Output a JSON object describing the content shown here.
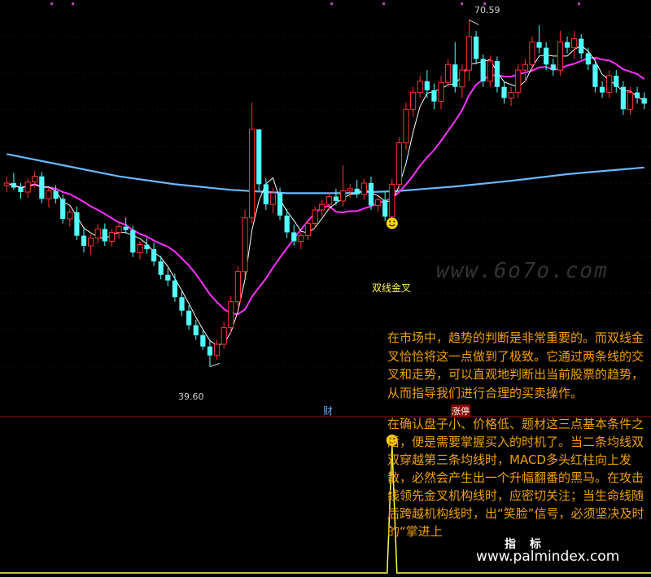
{
  "chart_data": {
    "type": "candlestick",
    "main_panel": {
      "price_range": [
        36,
        72
      ],
      "high_label": "70.59",
      "low_label": "39.60",
      "signal_label": "双线金叉",
      "candles": [
        [
          55.8,
          56.6,
          55.2,
          56.0
        ],
        [
          56.0,
          56.9,
          55.4,
          55.6
        ],
        [
          55.6,
          56.0,
          54.6,
          55.2
        ],
        [
          55.2,
          56.4,
          54.7,
          56.1
        ],
        [
          56.1,
          57.1,
          55.6,
          56.6
        ],
        [
          56.6,
          57.0,
          54.2,
          54.6
        ],
        [
          54.6,
          55.6,
          53.8,
          55.3
        ],
        [
          55.3,
          55.8,
          54.2,
          54.6
        ],
        [
          54.6,
          55.0,
          52.4,
          52.8
        ],
        [
          52.8,
          53.7,
          52.1,
          53.4
        ],
        [
          53.4,
          53.9,
          50.9,
          51.3
        ],
        [
          51.3,
          52.1,
          49.8,
          50.4
        ],
        [
          50.4,
          51.4,
          49.6,
          51.1
        ],
        [
          51.1,
          52.3,
          50.6,
          51.9
        ],
        [
          51.9,
          52.4,
          50.4,
          50.8
        ],
        [
          50.8,
          51.9,
          50.3,
          51.6
        ],
        [
          51.6,
          52.5,
          51.0,
          52.1
        ],
        [
          52.1,
          52.9,
          51.5,
          51.8
        ],
        [
          51.8,
          52.2,
          49.4,
          49.8
        ],
        [
          49.8,
          50.8,
          49.2,
          50.5
        ],
        [
          50.5,
          51.1,
          49.7,
          50.1
        ],
        [
          50.1,
          50.7,
          48.6,
          49.0
        ],
        [
          49.0,
          49.5,
          47.4,
          47.8
        ],
        [
          47.8,
          48.4,
          46.8,
          47.3
        ],
        [
          47.3,
          47.9,
          45.4,
          45.8
        ],
        [
          45.8,
          46.3,
          44.1,
          44.6
        ],
        [
          44.6,
          45.1,
          42.9,
          43.3
        ],
        [
          43.3,
          43.8,
          42.0,
          42.4
        ],
        [
          42.4,
          42.9,
          41.1,
          41.4
        ],
        [
          41.4,
          41.9,
          39.6,
          40.6
        ],
        [
          40.6,
          42.0,
          40.2,
          41.6
        ],
        [
          41.6,
          43.6,
          41.2,
          43.1
        ],
        [
          43.1,
          45.9,
          42.6,
          45.4
        ],
        [
          45.4,
          48.6,
          45.0,
          48.1
        ],
        [
          48.1,
          53.6,
          47.6,
          52.9
        ],
        [
          52.9,
          63.2,
          52.4,
          60.8
        ],
        [
          60.8,
          59.4,
          55.3,
          55.9
        ],
        [
          55.9,
          56.4,
          53.6,
          54.1
        ],
        [
          54.1,
          55.6,
          53.3,
          55.1
        ],
        [
          55.1,
          55.6,
          52.7,
          53.1
        ],
        [
          53.1,
          53.7,
          51.1,
          51.6
        ],
        [
          51.6,
          52.3,
          50.4,
          50.8
        ],
        [
          50.8,
          51.6,
          50.1,
          51.3
        ],
        [
          51.3,
          52.8,
          50.9,
          52.4
        ],
        [
          52.4,
          53.9,
          52.0,
          53.6
        ],
        [
          53.6,
          54.5,
          53.1,
          54.1
        ],
        [
          54.1,
          55.2,
          53.6,
          54.8
        ],
        [
          54.8,
          55.5,
          54.0,
          54.4
        ],
        [
          54.4,
          57.6,
          53.9,
          55.3
        ],
        [
          55.3,
          55.9,
          54.7,
          55.5
        ],
        [
          55.5,
          56.3,
          54.7,
          55.0
        ],
        [
          55.0,
          56.4,
          54.5,
          56.0
        ],
        [
          56.0,
          56.6,
          53.6,
          54.0
        ],
        [
          54.0,
          54.8,
          53.4,
          54.5
        ],
        [
          54.5,
          55.2,
          52.6,
          53.0
        ],
        [
          53.0,
          56.4,
          52.7,
          55.9
        ],
        [
          55.9,
          60.1,
          55.4,
          59.6
        ],
        [
          59.6,
          63.2,
          59.0,
          62.6
        ],
        [
          62.6,
          64.6,
          61.9,
          64.1
        ],
        [
          64.1,
          65.6,
          63.6,
          65.1
        ],
        [
          65.1,
          66.1,
          63.6,
          64.3
        ],
        [
          64.3,
          64.9,
          62.6,
          63.3
        ],
        [
          63.3,
          65.6,
          62.6,
          65.0
        ],
        [
          65.0,
          67.1,
          64.6,
          66.6
        ],
        [
          66.6,
          68.6,
          64.1,
          64.6
        ],
        [
          64.6,
          66.6,
          63.6,
          66.1
        ],
        [
          66.1,
          70.59,
          65.1,
          69.1
        ],
        [
          69.1,
          69.6,
          66.6,
          67.1
        ],
        [
          67.1,
          67.5,
          64.6,
          65.1
        ],
        [
          65.1,
          67.4,
          64.6,
          66.9
        ],
        [
          66.9,
          67.3,
          64.1,
          64.6
        ],
        [
          64.6,
          65.1,
          63.1,
          63.6
        ],
        [
          63.6,
          64.6,
          62.9,
          64.1
        ],
        [
          64.1,
          66.6,
          63.6,
          66.1
        ],
        [
          66.1,
          67.1,
          65.1,
          66.6
        ],
        [
          66.6,
          69.1,
          66.1,
          68.6
        ],
        [
          68.6,
          70.1,
          67.6,
          68.1
        ],
        [
          68.1,
          68.6,
          66.1,
          66.6
        ],
        [
          66.6,
          67.1,
          65.6,
          66.1
        ],
        [
          66.1,
          69.6,
          65.6,
          68.6
        ],
        [
          68.6,
          69.1,
          67.6,
          68.1
        ],
        [
          68.1,
          69.6,
          67.1,
          68.9
        ],
        [
          68.9,
          69.3,
          67.1,
          67.6
        ],
        [
          67.6,
          68.1,
          66.1,
          66.6
        ],
        [
          66.6,
          67.1,
          64.1,
          64.6
        ],
        [
          64.6,
          65.1,
          63.6,
          64.1
        ],
        [
          64.1,
          66.1,
          63.6,
          65.6
        ],
        [
          65.6,
          66.1,
          64.1,
          64.6
        ],
        [
          64.6,
          65.1,
          62.1,
          62.6
        ],
        [
          62.6,
          64.6,
          62.1,
          64.1
        ],
        [
          64.1,
          64.6,
          63.1,
          63.6
        ],
        [
          63.6,
          64.1,
          62.6,
          63.1
        ]
      ],
      "ma_short_color": "#ffffff",
      "ma_mid_color": "#ff30ff",
      "ma_long_color": "#6ab8ff",
      "ma_long": [
        58.6,
        57.6,
        56.6,
        55.9,
        55.4,
        55.1,
        55.1,
        55.3,
        55.7,
        56.2,
        56.8,
        57.4
      ],
      "ma_long_x": [
        0,
        8,
        16,
        24,
        32,
        40,
        48,
        56,
        64,
        72,
        80,
        92
      ]
    },
    "sub_panel": {
      "signal_index": 55,
      "signal_value": 1,
      "baseline": 0,
      "line_color": "#ffff40"
    }
  },
  "annotations": {
    "para1": "在市场中，趋势的判断是非常重要的。而双线金叉恰恰将这一点做到了极致。它通过两条线的交叉和走势，可以直观地判断出当前股票的趋势，从而指导我们进行合理的买卖操作。",
    "para2": "在确认盘子小、价格低、题材这三点基本条件之后，便是需要掌握买入的时机了。当二条均线双双穿越第三条均线时，MACD多头红柱向上发散，必然会产生出一个升幅翻番的黑马。在攻击线领先金叉机构线时，应密切关注；当生命线随后跨越机构线时，出“笑脸”信号，必须坚决及时的“掌进上"
  },
  "markers": {
    "cai": "财",
    "zhang": "涨停"
  },
  "watermarks": {
    "middle": "www.6o7o.com",
    "bottom": "www.palmindex.com",
    "overlay": "指 标"
  }
}
